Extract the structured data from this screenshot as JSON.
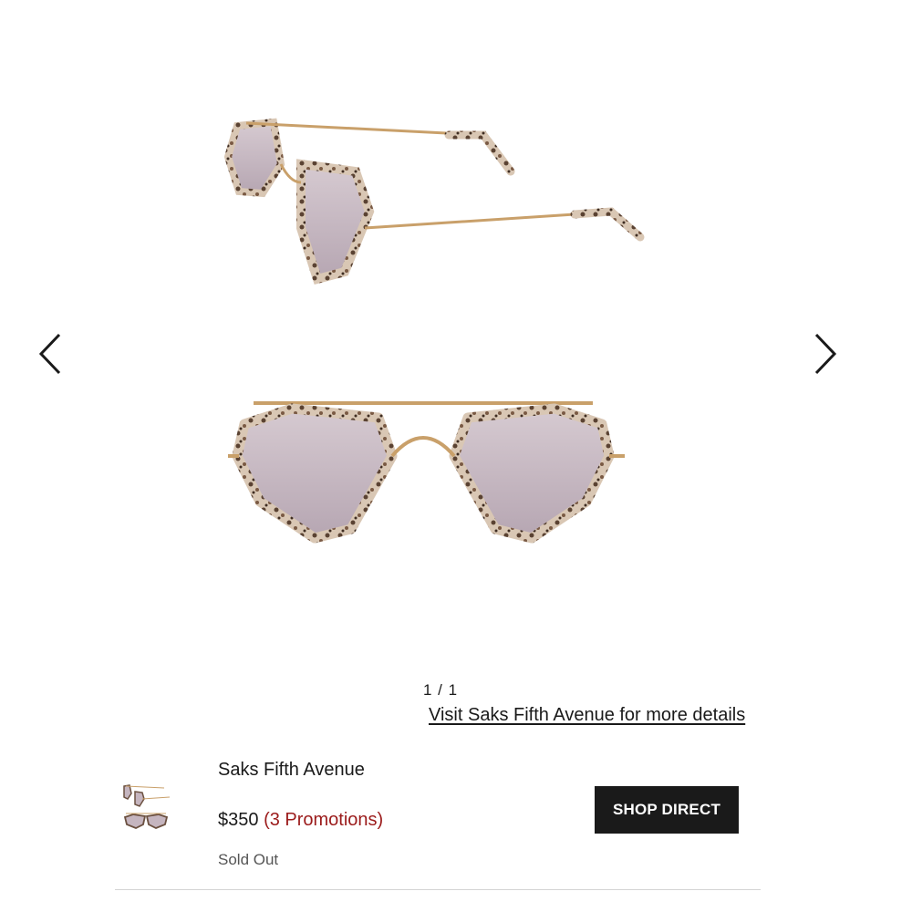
{
  "gallery": {
    "image_counter": "1 / 1",
    "details_link": "Visit Saks Fifth Avenue for more details",
    "prev_icon": "chevron-left-icon",
    "next_icon": "chevron-right-icon"
  },
  "offer": {
    "retailer": "Saks Fifth Avenue",
    "price": "$350",
    "promotions": "(3 Promotions)",
    "stock_status": "Sold Out",
    "shop_button": "SHOP DIRECT"
  },
  "colors": {
    "accent_promo": "#9b1b1b",
    "button_bg": "#1a1a1a",
    "frame_gold": "#c9a06a",
    "lens_tint": "#c5b5bf"
  }
}
